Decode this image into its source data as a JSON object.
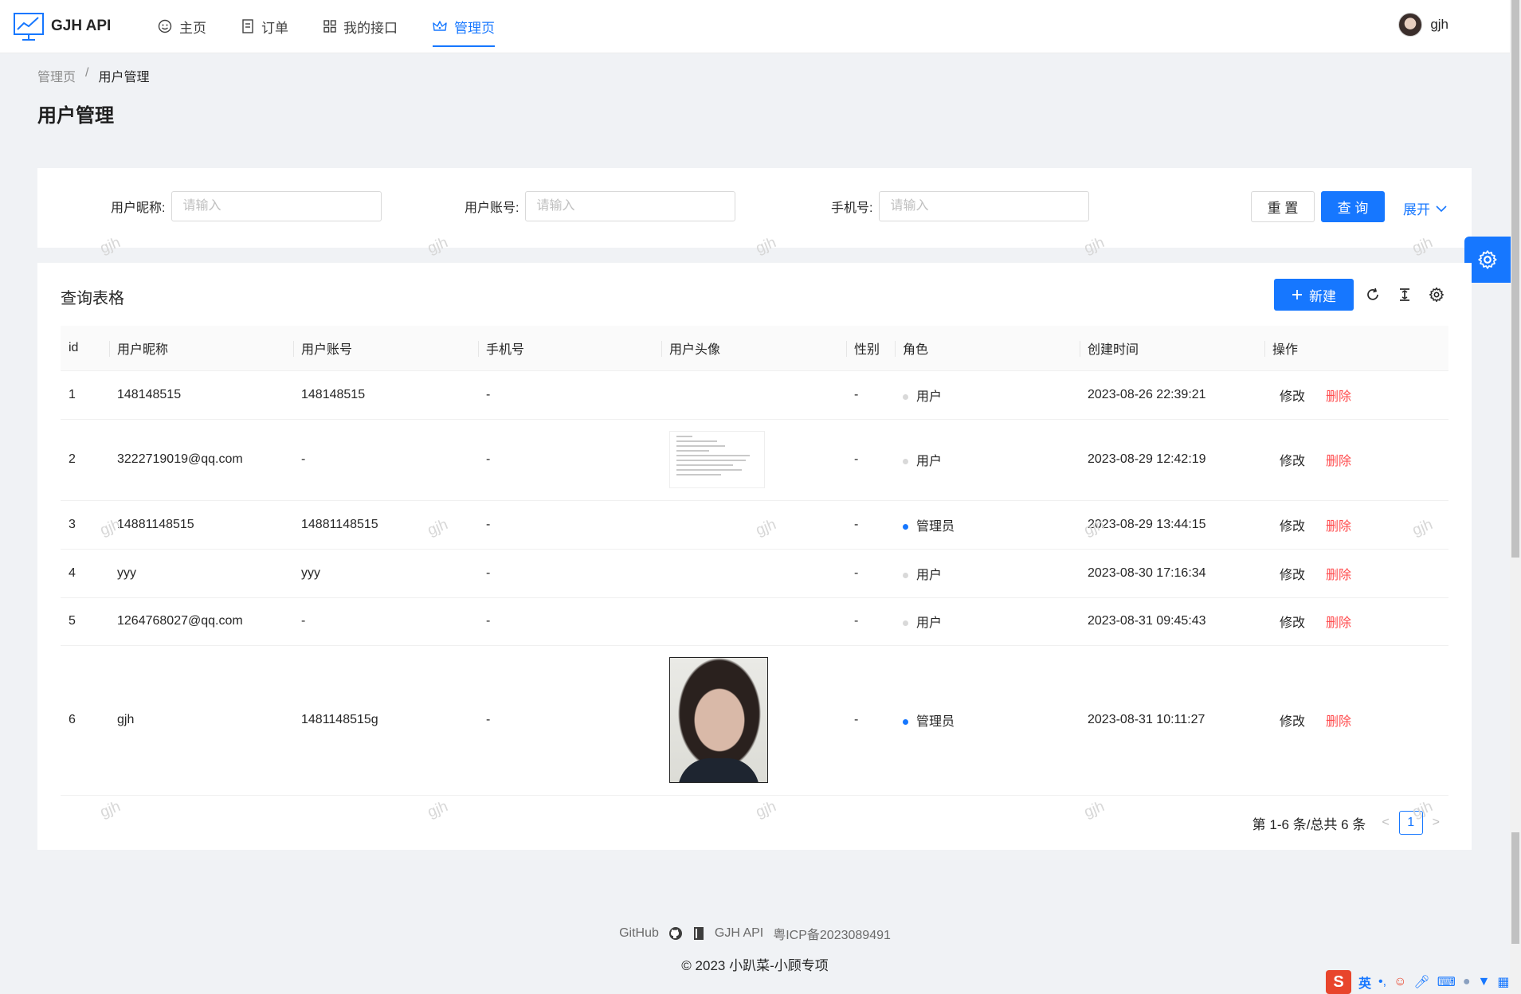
{
  "header": {
    "brand": "GJH API",
    "nav": [
      {
        "label": "主页",
        "icon": "smile-icon"
      },
      {
        "label": "订单",
        "icon": "document-icon"
      },
      {
        "label": "我的接口",
        "icon": "grid-icon"
      },
      {
        "label": "管理页",
        "icon": "crown-icon"
      }
    ],
    "active_nav": "管理页",
    "user_name": "gjh"
  },
  "breadcrumb": [
    "管理页",
    "/",
    "用户管理"
  ],
  "page_title": "用户管理",
  "search": {
    "nickname_label": "用户昵称:",
    "account_label": "用户账号:",
    "phone_label": "手机号:",
    "placeholder": "请输入",
    "reset_label": "重 置",
    "query_label": "查 询",
    "expand_label": "展开"
  },
  "table": {
    "title": "查询表格",
    "new_label": "新建",
    "columns": [
      "id",
      "用户昵称",
      "用户账号",
      "手机号",
      "用户头像",
      "性别",
      "角色",
      "创建时间",
      "操作"
    ],
    "rows": [
      {
        "id": "1",
        "nickname": "148148515",
        "account": "148148515",
        "phone": "-",
        "avatar": "",
        "gender": "-",
        "role": "用户",
        "created": "2023-08-26 22:39:21"
      },
      {
        "id": "2",
        "nickname": "3222719019@qq.com",
        "account": "-",
        "phone": "-",
        "avatar": "document-thumbnail",
        "gender": "-",
        "role": "用户",
        "created": "2023-08-29 12:42:19"
      },
      {
        "id": "3",
        "nickname": "14881148515",
        "account": "14881148515",
        "phone": "-",
        "avatar": "",
        "gender": "-",
        "role": "管理员",
        "created": "2023-08-29 13:44:15"
      },
      {
        "id": "4",
        "nickname": "yyy",
        "account": "yyy",
        "phone": "-",
        "avatar": "",
        "gender": "-",
        "role": "用户",
        "created": "2023-08-30 17:16:34"
      },
      {
        "id": "5",
        "nickname": "1264768027@qq.com",
        "account": "-",
        "phone": "-",
        "avatar": "",
        "gender": "-",
        "role": "用户",
        "created": "2023-08-31 09:45:43"
      },
      {
        "id": "6",
        "nickname": "gjh",
        "account": "1481148515g",
        "phone": "-",
        "avatar": "portrait-photo",
        "gender": "-",
        "role": "管理员",
        "created": "2023-08-31 10:11:27"
      }
    ],
    "edit_label": "修改",
    "delete_label": "删除",
    "pagination_summary": "第 1-6 条/总共 6 条",
    "current_page": "1"
  },
  "watermark": "gjh",
  "footer": {
    "github": "GitHub",
    "brand": "GJH API",
    "icp": "粤ICP备2023089491",
    "copyright": "2023 小趴菜-小顾专项"
  },
  "ime": {
    "mode": "英"
  },
  "colors": {
    "primary": "#1677ff",
    "danger": "#ff4d4f",
    "page_bg": "#f0f2f5"
  }
}
